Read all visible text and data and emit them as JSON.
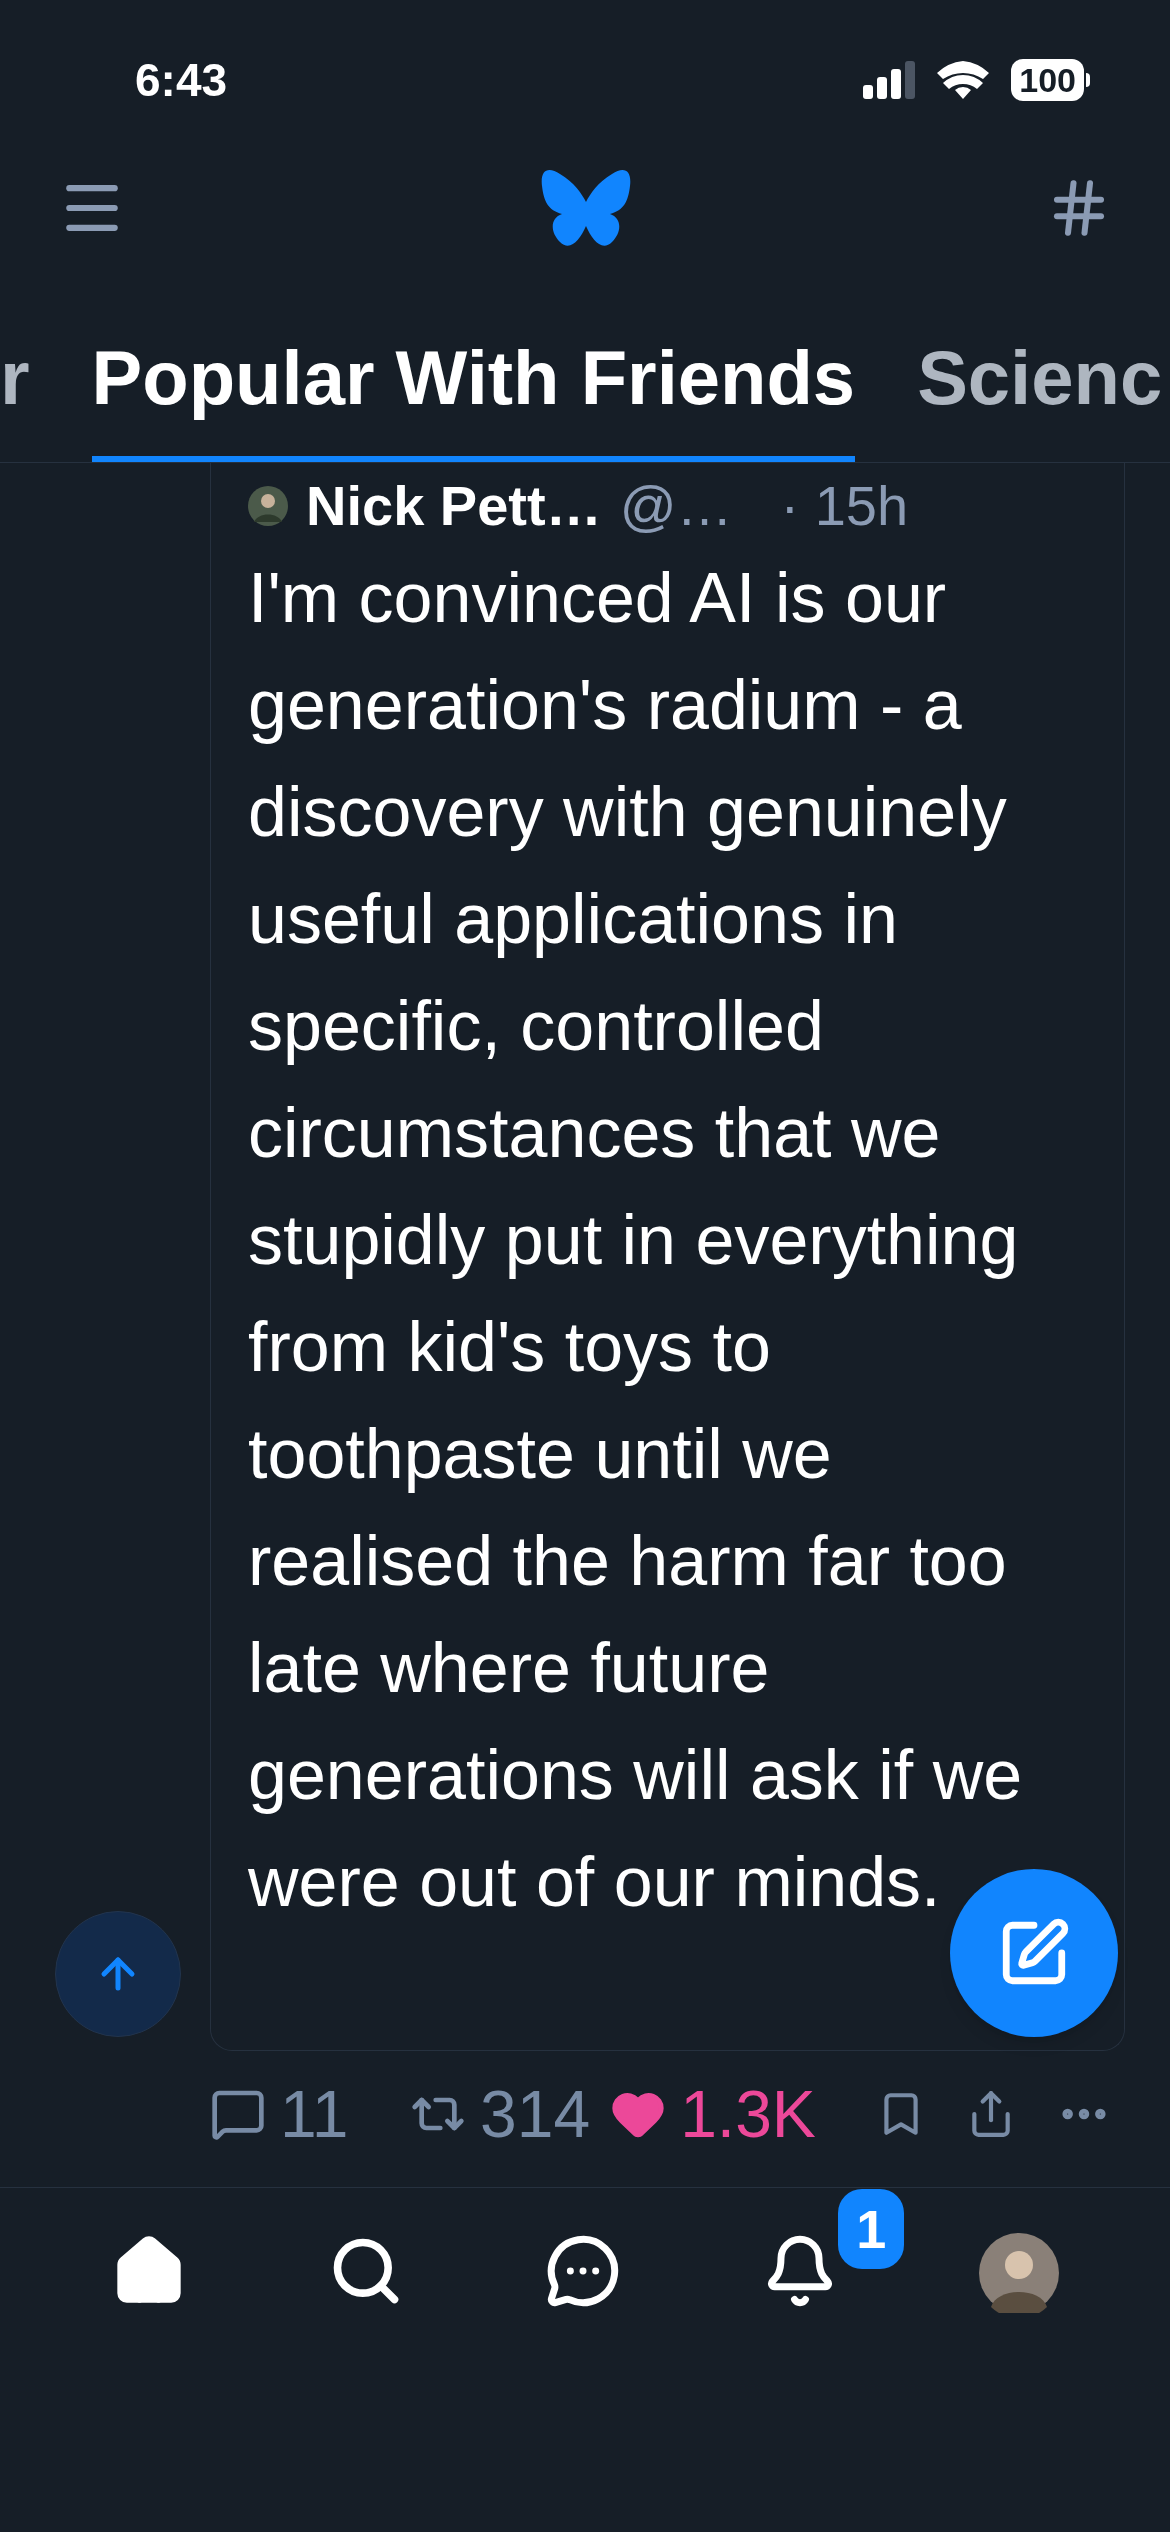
{
  "status_bar": {
    "time": "6:43",
    "battery": "100"
  },
  "tabs": [
    {
      "label": "r",
      "selected": false
    },
    {
      "label": "Popular With Friends",
      "selected": true
    },
    {
      "label": "Scienc",
      "selected": false
    }
  ],
  "post": {
    "author": "Nick Pett…",
    "handle": "@…",
    "time": "· 15h",
    "text": "I'm convinced AI is our generation's radium - a discovery with genuinely useful applications in specific, controlled circumstances that we stupidly put in everything from kid's toys to toothpaste until we realised the harm far too late where future generations will ask if we were out of our minds.",
    "replies": "11",
    "reposts": "314",
    "likes": "1.3K",
    "liked": true
  },
  "bottom_nav": {
    "notification_badge": "1"
  }
}
